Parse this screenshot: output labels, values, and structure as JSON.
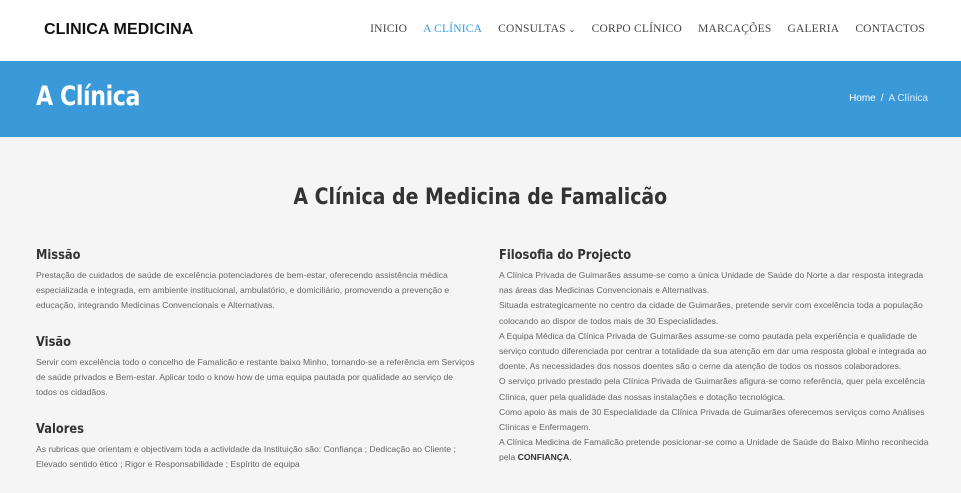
{
  "header": {
    "logo": "CLINICA MEDICINA",
    "nav": [
      {
        "label": "INICIO"
      },
      {
        "label": "A CLÍNICA"
      },
      {
        "label": "CONSULTAS"
      },
      {
        "label": "CORPO CLÍNICO"
      },
      {
        "label": "MARCAÇÕES"
      },
      {
        "label": "GALERIA"
      },
      {
        "label": "CONTACTOS"
      }
    ]
  },
  "banner": {
    "title": "A Clínica",
    "breadcrumb_home": "Home",
    "breadcrumb_sep": "/",
    "breadcrumb_current": "A Clínica"
  },
  "main": {
    "title": "A Clínica de Medicina de Famalicão",
    "missao": {
      "title": "Missão",
      "text": "Prestação de cuidados de saúde de excelência potenciadores de bem-estar, oferecendo assistência médica especializada e integrada, em ambiente institucional, ambulatório, e domiciliário, promovendo a prevenção e educação, integrando Medicinas Convencionais e Alternativas."
    },
    "visao": {
      "title": "Visão",
      "text": "Servir com excelência todo o concelho de Famalicão e restante baixo Minho, tornando-se a referência em Serviços de saúde privados e Bem-estar. Aplicar todo o know how de uma equipa pautada por qualidade ao serviço de todos os cidadãos."
    },
    "valores": {
      "title": "Valores",
      "text": "As rubricas que orientam e objectivam toda a actividade da Instituição são: Confiança ; Dedicação ao Cliente ; Elevado sentido ético ; Rigor e Responsabilidade ; Espírito de equipa"
    },
    "filosofia": {
      "title": "Filosofia do Projecto",
      "p1": "A Clínica Privada de Guimarães assume-se como a única Unidade de Saúde do Norte a dar resposta integrada nas áreas das Medicinas Convencionais e Alternativas.",
      "p2": "Situada estrategicamente no centro da cidade de Guimarães, pretende servir com excelência toda a população colocando ao dispor de todos mais de 30 Especialidades.",
      "p3": "A Equipa Médica da Clínica Privada de Guimarães assume-se como pautada pela experiência e qualidade de serviço contudo diferenciada por centrar a totalidade da sua atenção em dar uma resposta global e integrada ao doente. As necessidades dos nossos doentes são o cerne da atenção de todos os nossos colaboradores.",
      "p4": "O serviço privado prestado pela Clínica Privada de Guimarães afigura-se como referência, quer pela excelência Clínica, quer pela qualidade das nossas instalações e dotação tecnológica.",
      "p5": "Como apoio às mais de 30 Especialidade da Clínica Privada de Guimarães oferecemos serviços como Análises Clínicas e Enfermagem.",
      "p6_prefix": "A Clínica Medicina de Famalicão pretende posicionar-se como a Unidade de Saúde do Baixo Minho reconhecida pela ",
      "p6_strong": "CONFIANÇA",
      "p6_suffix": "."
    }
  },
  "colors": {
    "accent": "#3a9ad9",
    "background": "#f5f5f5"
  },
  "icons": {
    "consultas_dropdown": "chevron-down-icon"
  }
}
